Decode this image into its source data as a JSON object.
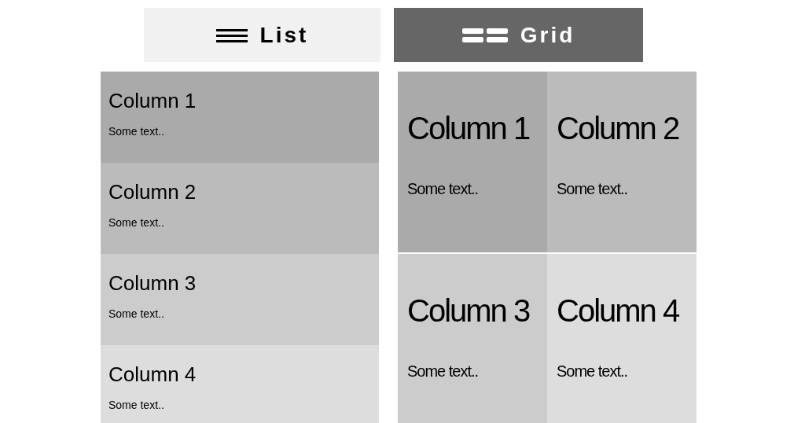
{
  "view_buttons": [
    {
      "kind": "list",
      "label": "List",
      "selected": false
    },
    {
      "kind": "grid",
      "label": "Grid",
      "selected": true
    }
  ],
  "list_view": [
    {
      "title": "Column 1",
      "text": "Some text..",
      "color": "#aaaaaa"
    },
    {
      "title": "Column 2",
      "text": "Some text..",
      "color": "#bbbbbb"
    },
    {
      "title": "Column 3",
      "text": "Some text..",
      "color": "#cccccc"
    },
    {
      "title": "Column 4",
      "text": "Some text..",
      "color": "#dddddd"
    }
  ],
  "grid_view": [
    {
      "title": "Column 1",
      "text": "Some text..",
      "color": "#aaaaaa"
    },
    {
      "title": "Column 2",
      "text": "Some text..",
      "color": "#bbbbbb"
    },
    {
      "title": "Column 3",
      "text": "Some text..",
      "color": "#cccccc"
    },
    {
      "title": "Column 4",
      "text": "Some text..",
      "color": "#dddddd"
    }
  ]
}
